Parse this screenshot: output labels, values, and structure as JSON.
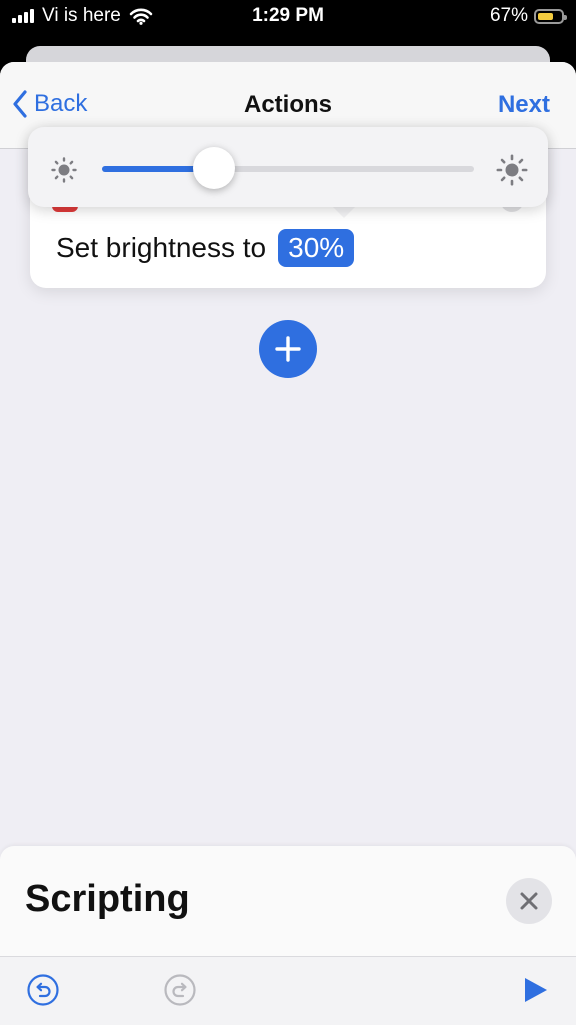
{
  "status_bar": {
    "carrier": "Vi is here",
    "time": "1:29 PM",
    "battery_text": "67%",
    "battery_level": 0.67
  },
  "nav": {
    "back_label": "Back",
    "title": "Actions",
    "next_label": "Next"
  },
  "action": {
    "text": "Set brightness to",
    "value_label": "30%"
  },
  "brightness": {
    "level": 0.3
  },
  "bottom_sheet": {
    "title": "Scripting"
  },
  "colors": {
    "accent": "#2f6fe0",
    "battery_fill": "#f4cc3f"
  },
  "icons": [
    "wifi-icon",
    "chevron-left-icon",
    "sun-small-icon",
    "sun-large-icon",
    "plus-icon",
    "close-icon",
    "undo-icon",
    "redo-icon",
    "play-icon"
  ]
}
